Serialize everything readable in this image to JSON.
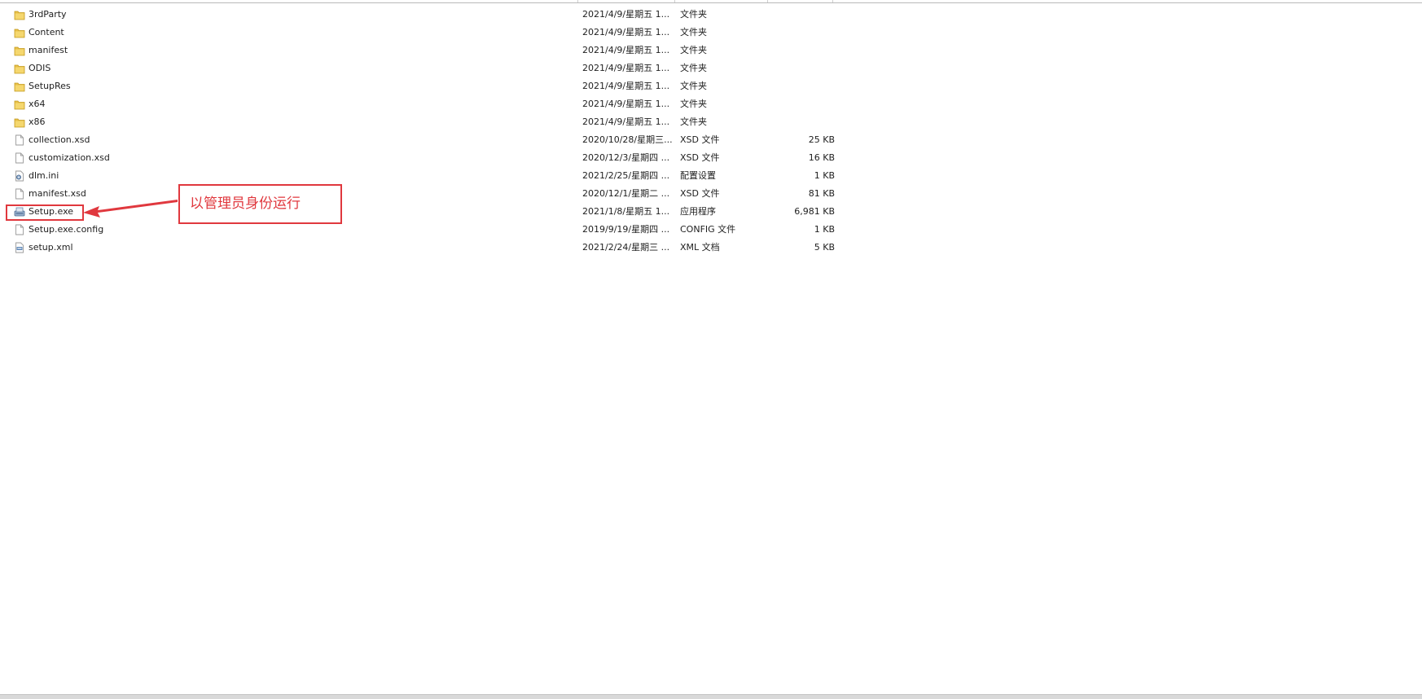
{
  "files": [
    {
      "name": "3rdParty",
      "date": "2021/4/9/星期五 1...",
      "type": "文件夹",
      "size": "",
      "icon": "folder-icon"
    },
    {
      "name": "Content",
      "date": "2021/4/9/星期五 1...",
      "type": "文件夹",
      "size": "",
      "icon": "folder-icon"
    },
    {
      "name": "manifest",
      "date": "2021/4/9/星期五 1...",
      "type": "文件夹",
      "size": "",
      "icon": "folder-icon"
    },
    {
      "name": "ODIS",
      "date": "2021/4/9/星期五 1...",
      "type": "文件夹",
      "size": "",
      "icon": "folder-icon"
    },
    {
      "name": "SetupRes",
      "date": "2021/4/9/星期五 1...",
      "type": "文件夹",
      "size": "",
      "icon": "folder-icon"
    },
    {
      "name": "x64",
      "date": "2021/4/9/星期五 1...",
      "type": "文件夹",
      "size": "",
      "icon": "folder-icon"
    },
    {
      "name": "x86",
      "date": "2021/4/9/星期五 1...",
      "type": "文件夹",
      "size": "",
      "icon": "folder-icon"
    },
    {
      "name": "collection.xsd",
      "date": "2020/10/28/星期三...",
      "type": "XSD 文件",
      "size": "25 KB",
      "icon": "file-icon"
    },
    {
      "name": "customization.xsd",
      "date": "2020/12/3/星期四 ...",
      "type": "XSD 文件",
      "size": "16 KB",
      "icon": "file-icon"
    },
    {
      "name": "dlm.ini",
      "date": "2021/2/25/星期四 ...",
      "type": "配置设置",
      "size": "1 KB",
      "icon": "ini-settings-icon"
    },
    {
      "name": "manifest.xsd",
      "date": "2020/12/1/星期二 ...",
      "type": "XSD 文件",
      "size": "81 KB",
      "icon": "file-icon"
    },
    {
      "name": "Setup.exe",
      "date": "2021/1/8/星期五 1...",
      "type": "应用程序",
      "size": "6,981 KB",
      "icon": "installer-icon"
    },
    {
      "name": "Setup.exe.config",
      "date": "2019/9/19/星期四 ...",
      "type": "CONFIG 文件",
      "size": "1 KB",
      "icon": "file-icon"
    },
    {
      "name": "setup.xml",
      "date": "2021/2/24/星期三 ...",
      "type": "XML 文档",
      "size": "5 KB",
      "icon": "xml-file-icon"
    }
  ],
  "annotation": {
    "callout_text": "以管理员身份运行",
    "color": "#e0383e"
  }
}
